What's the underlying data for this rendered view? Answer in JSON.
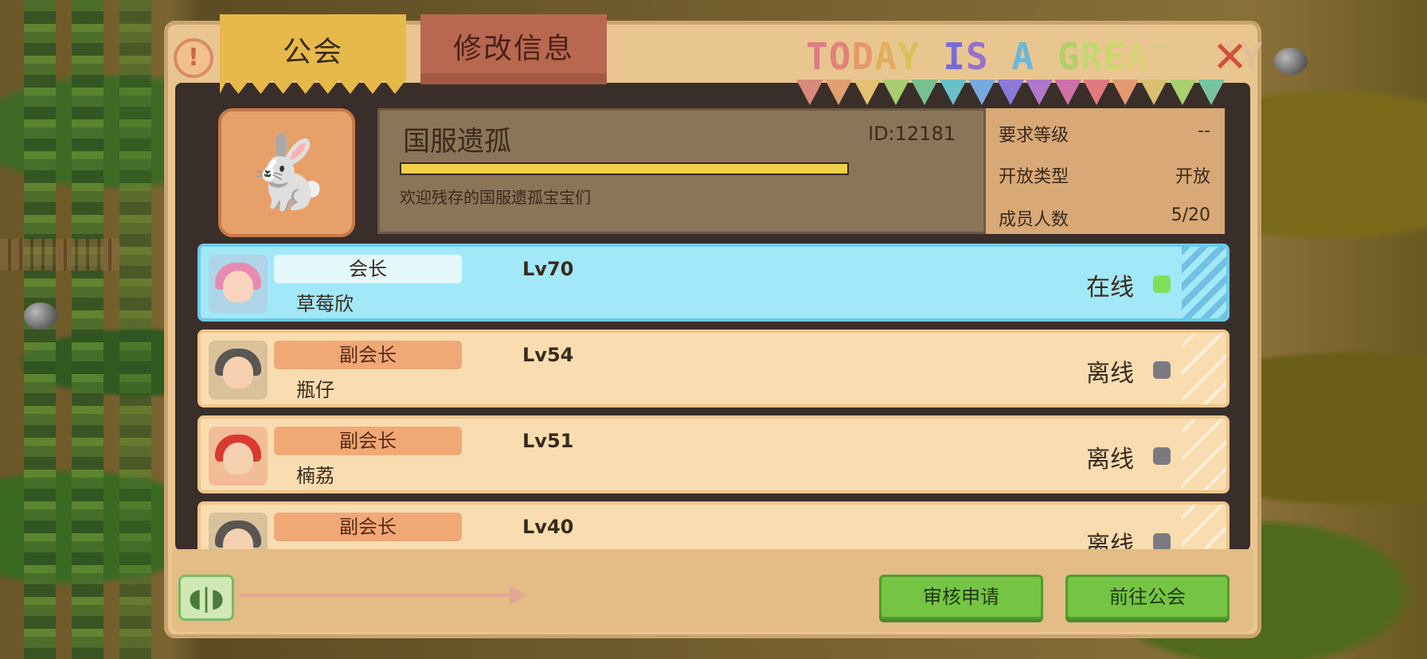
{
  "tabs": {
    "guild_label": "公会",
    "edit_label": "修改信息"
  },
  "banner": {
    "letters": [
      "T",
      "O",
      "D",
      "A",
      "Y",
      " ",
      "I",
      "S",
      " ",
      "A",
      " ",
      "G",
      "R",
      "E",
      "A",
      "T",
      " ",
      "D",
      "A",
      "Y"
    ],
    "colors": [
      "#e27a88",
      "#e2837a",
      "#e39a6c",
      "#e0ae60",
      "#d8c05c",
      "",
      "#7a6ad8",
      "#9870cc",
      "",
      "#6ab8d8",
      "",
      "#b0d06a",
      "#c4d870",
      "#d0d470",
      "#dcd07a",
      "#e0c88a",
      "",
      "#e6c892",
      "#e8c096",
      "#e4bc98"
    ],
    "flag_colors": [
      "#d88a7a",
      "#e0a070",
      "#e4c070",
      "#a8cc70",
      "#78c090",
      "#6ac0c8",
      "#78a8e0",
      "#8a7ad8",
      "#b078cc",
      "#d070a8",
      "#e07a80",
      "#e49a70",
      "#d8c070",
      "#a8d070",
      "#78c4a0"
    ]
  },
  "guild": {
    "name": "国服遗孤",
    "id_text": "ID:12181",
    "description": "欢迎残存的国服遗孤宝宝们",
    "xp_progress": 1.0,
    "stats": [
      {
        "label": "要求等级",
        "value": "--"
      },
      {
        "label": "开放类型",
        "value": "开放"
      },
      {
        "label": "成员人数",
        "value": "5/20"
      }
    ]
  },
  "members": [
    {
      "role": "会长",
      "name": "草莓欣",
      "level": "Lv70",
      "status": "在线",
      "online": true,
      "hair": "#e88ab0",
      "skin": "#f8d4c0"
    },
    {
      "role": "副会长",
      "name": "瓶仔",
      "level": "Lv54",
      "status": "离线",
      "online": false,
      "hair": "#5a5652",
      "skin": "#f4d0b0"
    },
    {
      "role": "副会长",
      "name": "楠荔",
      "level": "Lv51",
      "status": "离线",
      "online": false,
      "hair": "#d83a30",
      "skin": "#f4d0b0"
    },
    {
      "role": "副会长",
      "name": "",
      "level": "Lv40",
      "status": "离线",
      "online": false,
      "hair": "#5a5652",
      "skin": "#f4d0b0"
    }
  ],
  "colors": {
    "online_dot": "#7ee05a",
    "offline_dot": "#7a7a80"
  },
  "footer": {
    "review_label": "审核申请",
    "goto_label": "前往公会"
  },
  "icons": {
    "help": "exclamation-icon",
    "close": "close-icon",
    "sound": "sound-icon",
    "avatar": "rabbit-icon"
  }
}
